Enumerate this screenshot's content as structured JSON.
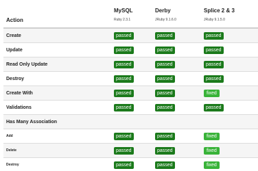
{
  "header": {
    "action": "Action",
    "databases": [
      {
        "name": "MySQL",
        "version": "Ruby 2.3.1"
      },
      {
        "name": "Derby",
        "version": "JRuby 9.1.6.0"
      },
      {
        "name": "Splice 2 & 3",
        "version": "JRuby 9.1.5.0"
      }
    ]
  },
  "rows": [
    {
      "label": "Create",
      "kind": "normal",
      "results": [
        "passed",
        "passed",
        "passed"
      ]
    },
    {
      "label": "Update",
      "kind": "normal",
      "results": [
        "passed",
        "passed",
        "passed"
      ]
    },
    {
      "label": "Read Only Update",
      "kind": "normal",
      "results": [
        "passed",
        "passed",
        "passed"
      ]
    },
    {
      "label": "Destroy",
      "kind": "normal",
      "results": [
        "passed",
        "passed",
        "passed"
      ]
    },
    {
      "label": "Create With",
      "kind": "normal",
      "results": [
        "passed",
        "passed",
        "fixed"
      ]
    },
    {
      "label": "Validations",
      "kind": "normal",
      "results": [
        "passed",
        "passed",
        "passed"
      ]
    },
    {
      "label": "Has Many Association",
      "kind": "section",
      "results": []
    },
    {
      "label": "Add",
      "kind": "small",
      "results": [
        "passed",
        "passed",
        "fixed"
      ]
    },
    {
      "label": "Delete",
      "kind": "small",
      "results": [
        "passed",
        "passed",
        "fixed"
      ]
    },
    {
      "label": "Destroy",
      "kind": "small",
      "results": [
        "passed",
        "passed",
        "fixed"
      ]
    }
  ],
  "colors": {
    "passed": "#1b7a1b",
    "fixed": "#39b339",
    "stripe": "#f5f5f5"
  }
}
